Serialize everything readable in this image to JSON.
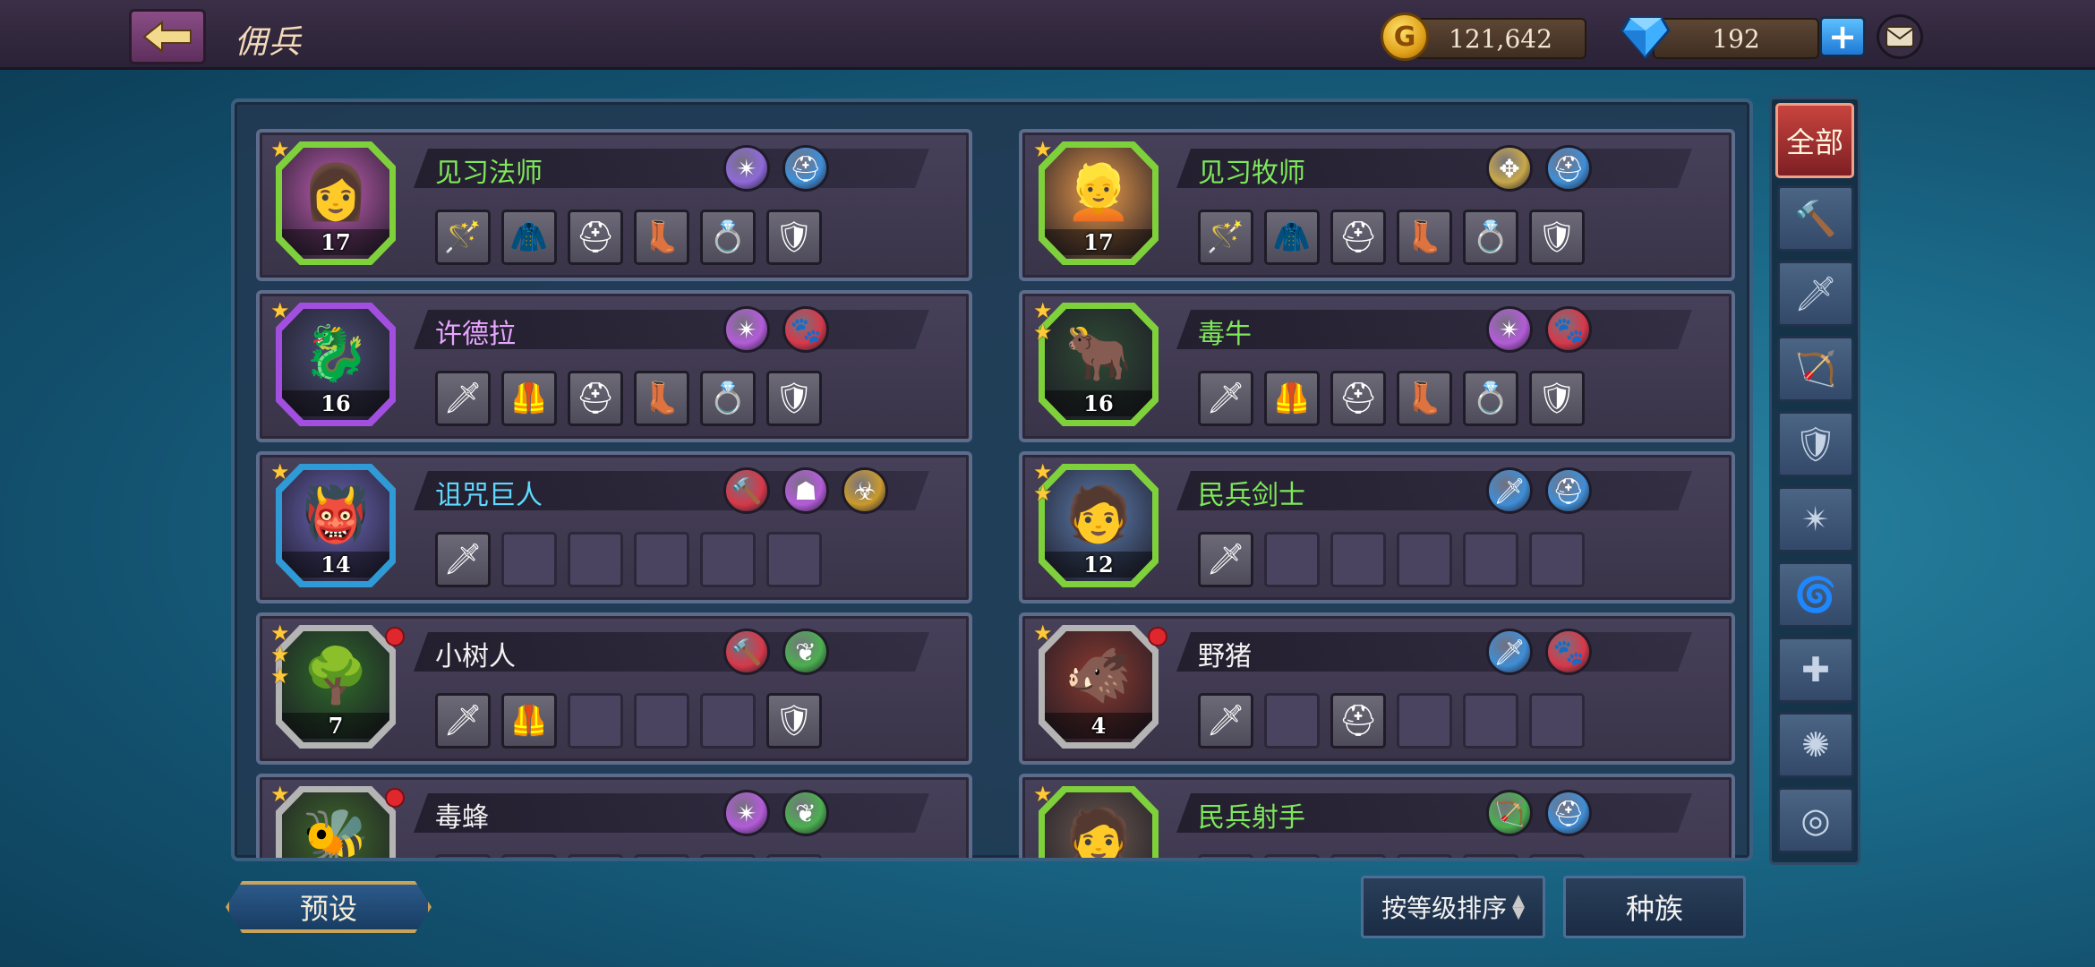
{
  "header": {
    "title": "佣兵",
    "gold": "121,642",
    "gems": "192",
    "gold_symbol": "G"
  },
  "colors": {
    "green_name": "#7ee85a",
    "purple_name": "#e7a6ff",
    "cyan_name": "#5fd8ff",
    "white_name": "#f2f2f2"
  },
  "mercenaries": [
    {
      "name": "见习法师",
      "level": "17",
      "stars": 1,
      "name_color": "green",
      "frame": "#7fd13c",
      "bg": "#c25fb5",
      "face": "👩",
      "traits": [
        "arcane-icon",
        "helmet-icon"
      ],
      "trait_colors": [
        "#8e6ad8",
        "#3f8ed6"
      ],
      "equip": [
        "🪄",
        "🧥",
        "⛑",
        "👢",
        "💍",
        "🛡"
      ],
      "dot": false
    },
    {
      "name": "见习牧师",
      "level": "17",
      "stars": 1,
      "name_color": "green",
      "frame": "#7fd13c",
      "bg": "#e99a4b",
      "face": "👱",
      "traits": [
        "holy-icon",
        "helmet-icon"
      ],
      "trait_colors": [
        "#c8a84a",
        "#3f8ed6"
      ],
      "equip": [
        "🪄",
        "🧥",
        "⛑",
        "👢",
        "💍",
        "🛡"
      ],
      "dot": false
    },
    {
      "name": "许德拉",
      "level": "16",
      "stars": 1,
      "name_color": "purple",
      "frame": "#a24fe0",
      "bg": "#4b4e74",
      "face": "🐉",
      "traits": [
        "arcane-icon",
        "paw-icon"
      ],
      "trait_colors": [
        "#b35cd8",
        "#d6394a"
      ],
      "equip": [
        "🗡",
        "🦺",
        "⛑",
        "👢",
        "💍",
        "🛡"
      ],
      "dot": false
    },
    {
      "name": "毒牛",
      "level": "16",
      "stars": 2,
      "name_color": "green",
      "frame": "#7fd13c",
      "bg": "#2f4b34",
      "face": "🐂",
      "traits": [
        "arcane-icon",
        "paw-icon"
      ],
      "trait_colors": [
        "#b35cd8",
        "#d6394a"
      ],
      "equip": [
        "🗡",
        "🦺",
        "⛑",
        "👢",
        "💍",
        "🛡"
      ],
      "dot": false
    },
    {
      "name": "诅咒巨人",
      "level": "14",
      "stars": 1,
      "name_color": "cyan",
      "frame": "#2f9ad6",
      "bg": "#6b66b8",
      "face": "👹",
      "traits": [
        "hammer-icon",
        "hood-icon",
        "mask-icon"
      ],
      "trait_colors": [
        "#d6394a",
        "#b35cd8",
        "#c99a2e"
      ],
      "equip": [
        "🗡",
        "",
        "",
        "",
        "",
        ""
      ],
      "dot": false
    },
    {
      "name": "民兵剑士",
      "level": "12",
      "stars": 2,
      "name_color": "green",
      "frame": "#7fd13c",
      "bg": "#5d7fb0",
      "face": "🧑",
      "traits": [
        "sword-icon",
        "helmet-icon"
      ],
      "trait_colors": [
        "#3f8ed6",
        "#3f8ed6"
      ],
      "equip": [
        "🗡",
        "",
        "",
        "",
        "",
        ""
      ],
      "dot": false
    },
    {
      "name": "小树人",
      "level": "7",
      "stars": 3,
      "name_color": "white",
      "frame": "#b4b4b4",
      "bg": "#2f6b2a",
      "face": "🌳",
      "traits": [
        "hammer-icon",
        "drop-icon"
      ],
      "trait_colors": [
        "#d6394a",
        "#4caf50"
      ],
      "equip": [
        "🗡",
        "🦺",
        "",
        "",
        "",
        "🛡"
      ],
      "dot": true
    },
    {
      "name": "野猪",
      "level": "4",
      "stars": 1,
      "name_color": "white",
      "frame": "#b4b4b4",
      "bg": "#8b3a2e",
      "face": "🐗",
      "traits": [
        "sword-icon",
        "paw-icon"
      ],
      "trait_colors": [
        "#3f8ed6",
        "#d6394a"
      ],
      "equip": [
        "🗡",
        "",
        "⛑",
        "",
        "",
        ""
      ],
      "dot": true
    },
    {
      "name": "毒蜂",
      "level": "",
      "stars": 1,
      "name_color": "white",
      "frame": "#b4b4b4",
      "bg": "#3f6b2a",
      "face": "🐝",
      "traits": [
        "arcane-icon",
        "drop-icon"
      ],
      "trait_colors": [
        "#b35cd8",
        "#4caf50"
      ],
      "equip": [
        "",
        "",
        "",
        "",
        "",
        ""
      ],
      "dot": true
    },
    {
      "name": "民兵射手",
      "level": "",
      "stars": 1,
      "name_color": "green",
      "frame": "#7fd13c",
      "bg": "#6b5a4e",
      "face": "🧑",
      "traits": [
        "bow-icon",
        "helmet-icon"
      ],
      "trait_colors": [
        "#4caf50",
        "#3f8ed6"
      ],
      "equip": [
        "",
        "",
        "",
        "",
        "",
        ""
      ],
      "dot": false
    }
  ],
  "filters": {
    "all_label": "全部",
    "items": [
      {
        "icon": "hammer-icon",
        "glyph": "🔨"
      },
      {
        "icon": "sword-icon",
        "glyph": "🗡"
      },
      {
        "icon": "bow-icon",
        "glyph": "🏹"
      },
      {
        "icon": "shield-icon",
        "glyph": "🛡"
      },
      {
        "icon": "arcane-icon",
        "glyph": "✴"
      },
      {
        "icon": "spiral-icon",
        "glyph": "🌀"
      },
      {
        "icon": "holy-cross-icon",
        "glyph": "✚"
      },
      {
        "icon": "claw-icon",
        "glyph": "✺"
      },
      {
        "icon": "target-icon",
        "glyph": "◎"
      }
    ]
  },
  "footer": {
    "preset_label": "预设",
    "sort_label": "按等级排序",
    "race_label": "种族"
  }
}
